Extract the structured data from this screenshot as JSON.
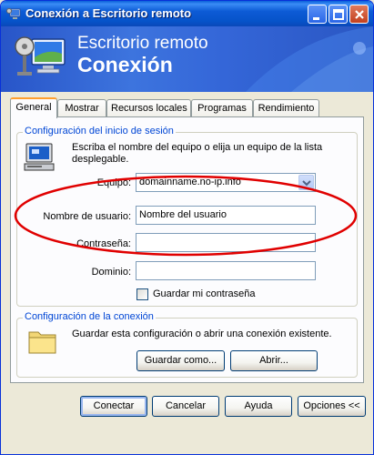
{
  "window": {
    "title": "Conexión a Escritorio remoto"
  },
  "banner": {
    "line1": "Escritorio remoto",
    "line2": "Conexión"
  },
  "tabs": [
    {
      "label": "General",
      "active": true
    },
    {
      "label": "Mostrar",
      "active": false
    },
    {
      "label": "Recursos locales",
      "active": false
    },
    {
      "label": "Programas",
      "active": false
    },
    {
      "label": "Rendimiento",
      "active": false
    }
  ],
  "login_group": {
    "title": "Configuración del inicio de sesión",
    "instruction_line1": "Escriba el nombre del equipo o elija un equipo de la lista",
    "instruction_line2": "desplegable.",
    "computer_label": "Equipo:",
    "computer_value": "domainname.no-ip.info",
    "username_label": "Nombre de usuario:",
    "username_value": "Nombre del usuario",
    "password_label": "Contraseña:",
    "password_value": "",
    "domain_label": "Dominio:",
    "domain_value": "",
    "save_password_label": "Guardar mi contraseña",
    "save_password_checked": false
  },
  "connection_group": {
    "title": "Configuración de la conexión",
    "description": "Guardar esta configuración o abrir una conexión existente.",
    "save_as_label": "Guardar como...",
    "open_label": "Abrir..."
  },
  "footer": {
    "connect_label": "Conectar",
    "cancel_label": "Cancelar",
    "help_label": "Ayuda",
    "options_label": "Opciones <<"
  },
  "colors": {
    "annotation": "#e00000",
    "titlebar": "#0a5fd8",
    "group_title": "#0046d5"
  },
  "icons": {
    "title": "remote-desktop-icon",
    "computer": "computer-icon",
    "folder": "folder-icon"
  }
}
